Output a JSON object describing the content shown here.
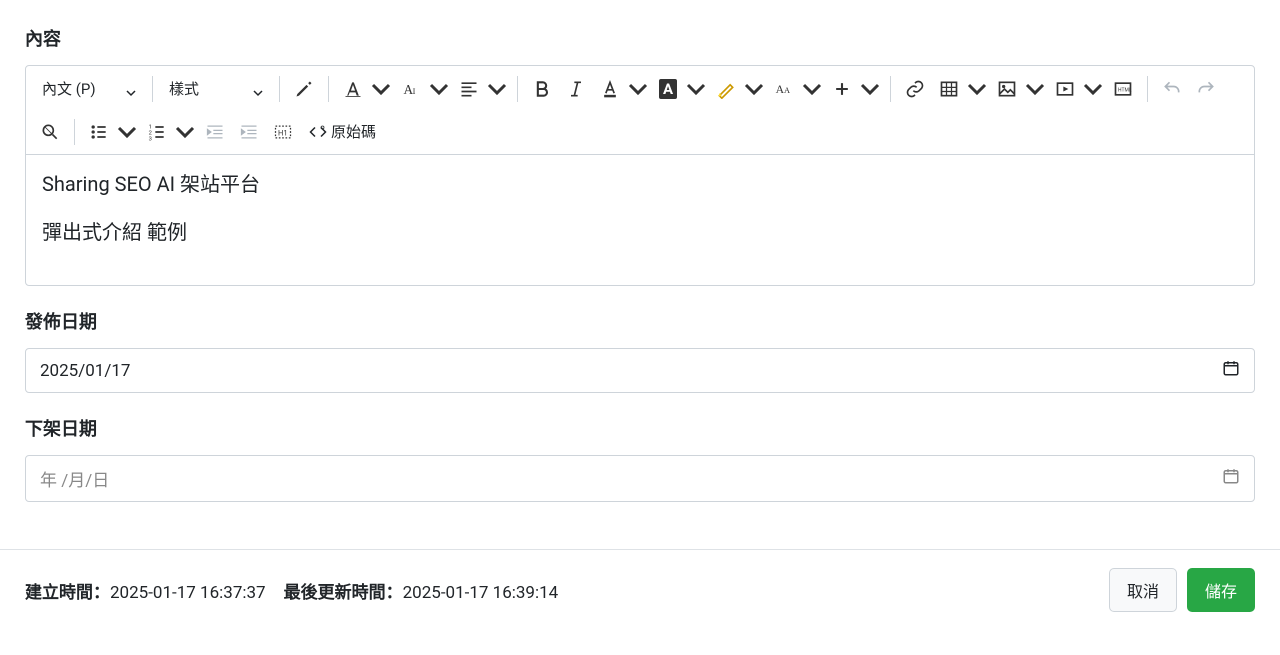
{
  "labels": {
    "content": "內容",
    "publish_date": "發佈日期",
    "expire_date": "下架日期"
  },
  "toolbar": {
    "paragraph_format": "內文 (P)",
    "style": "樣式",
    "source_code": "原始碼"
  },
  "editor": {
    "line1": "Sharing SEO AI 架站平台",
    "line2": "彈出式介紹 範例"
  },
  "dates": {
    "publish_value": "2025/01/17",
    "expire_placeholder": "年 /月/日"
  },
  "meta": {
    "created_label": "建立時間：",
    "created_value": "2025-01-17 16:37:37",
    "updated_label": "最後更新時間：",
    "updated_value": "2025-01-17 16:39:14"
  },
  "buttons": {
    "cancel": "取消",
    "save": "儲存"
  }
}
